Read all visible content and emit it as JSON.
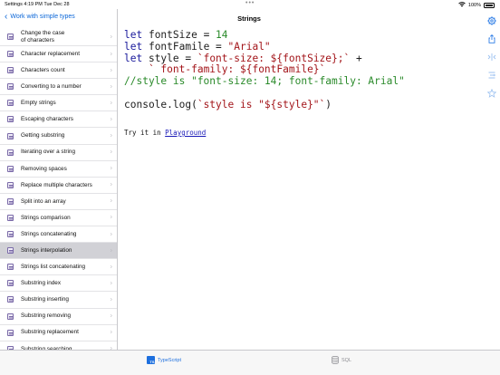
{
  "status": {
    "time": "Settings  4:19 PM   Tue Dec 28",
    "battery": "100%"
  },
  "sidebar": {
    "back_label": "Work with simple types",
    "items": [
      {
        "label": "Change the case\nof characters",
        "selected": false
      },
      {
        "label": "Character replacement",
        "selected": false
      },
      {
        "label": "Characters count",
        "selected": false
      },
      {
        "label": "Converting to a number",
        "selected": false
      },
      {
        "label": "Empty strings",
        "selected": false
      },
      {
        "label": "Escaping characters",
        "selected": false
      },
      {
        "label": "Getting substring",
        "selected": false
      },
      {
        "label": "Iterating over a string",
        "selected": false
      },
      {
        "label": "Removing spaces",
        "selected": false
      },
      {
        "label": "Replace multiple characters",
        "selected": false
      },
      {
        "label": "Split into an array",
        "selected": false
      },
      {
        "label": "Strings comparison",
        "selected": false
      },
      {
        "label": "Strings concatenating",
        "selected": false
      },
      {
        "label": "Strings interpolation",
        "selected": true
      },
      {
        "label": "Strings list concatenating",
        "selected": false
      },
      {
        "label": "Substring index",
        "selected": false
      },
      {
        "label": "Substring inserting",
        "selected": false
      },
      {
        "label": "Substring removing",
        "selected": false
      },
      {
        "label": "Substring replacement",
        "selected": false
      },
      {
        "label": "Substring searching",
        "selected": false
      }
    ]
  },
  "main": {
    "title": "Strings",
    "try_prefix": "Try it in ",
    "try_link": "Playground"
  },
  "toolbar": {
    "icons": [
      "gear-icon",
      "share-icon",
      "compare-icon",
      "filter-icon",
      "star-icon"
    ]
  },
  "tabs": [
    {
      "label": "TypeScript",
      "icon": "ts-icon",
      "active": true
    },
    {
      "label": "SQL",
      "icon": "database-icon",
      "active": false
    }
  ],
  "colors": {
    "accent": "#1d6fde",
    "keyword": "#1a1a9c",
    "string": "#a3151a",
    "number": "#2a8a2a",
    "comment": "#2a8a2a",
    "selection": "#d1d1d6"
  }
}
